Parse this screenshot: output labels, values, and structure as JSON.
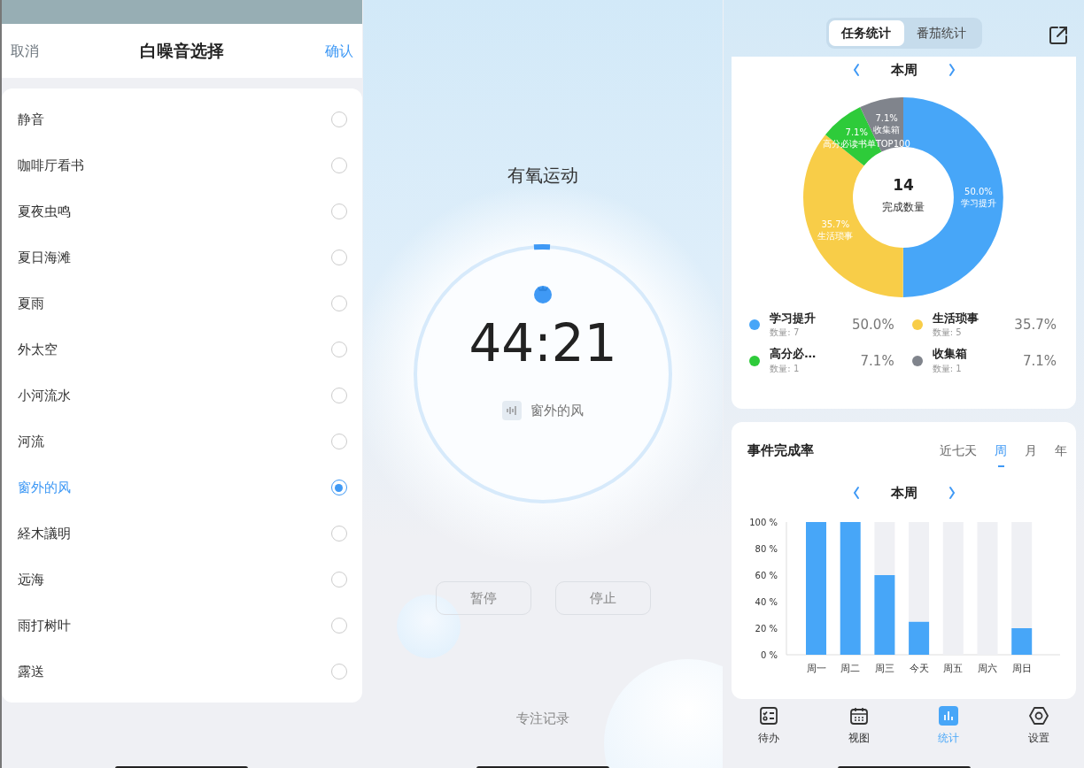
{
  "noise_picker": {
    "cancel": "取消",
    "title": "白噪音选择",
    "confirm": "确认",
    "options": [
      {
        "label": "静音",
        "selected": false
      },
      {
        "label": "咖啡厅看书",
        "selected": false
      },
      {
        "label": "夏夜虫鸣",
        "selected": false
      },
      {
        "label": "夏日海滩",
        "selected": false
      },
      {
        "label": "夏雨",
        "selected": false
      },
      {
        "label": "外太空",
        "selected": false
      },
      {
        "label": "小河流水",
        "selected": false
      },
      {
        "label": "河流",
        "selected": false
      },
      {
        "label": "窗外的风",
        "selected": true
      },
      {
        "label": "経木議明",
        "selected": false
      },
      {
        "label": "远海",
        "selected": false
      },
      {
        "label": "雨打树叶",
        "selected": false
      },
      {
        "label": "露送",
        "selected": false
      }
    ]
  },
  "focus_timer": {
    "task": "有氧运动",
    "level": 0.02,
    "time": "44:21",
    "sound": "窗外的风",
    "buttons": [
      "暂停",
      "停止"
    ],
    "history_link": "专注记录"
  },
  "stats": {
    "tabs": [
      {
        "label": "任务统计",
        "selected": true
      },
      {
        "label": "番茄统计",
        "selected": false
      }
    ],
    "task_card": {
      "period": "本周",
      "center_value": "14",
      "center_label": "完成数量",
      "chart_data": {
        "type": "donut",
        "categories": [
          "学习提升",
          "生活琐事",
          "高分必读书单TOP100",
          "收集箱"
        ],
        "values": [
          50.0,
          35.7,
          7.1,
          7.1
        ],
        "value_labels": [
          "50.0%",
          "35.7%",
          "7.1%",
          "7.1%"
        ]
      },
      "legend": [
        {
          "name": "学习提升",
          "count": "数量: 7",
          "percent": "50.0%",
          "color": "#47a6f8"
        },
        {
          "name": "生活琐事",
          "count": "数量: 5",
          "percent": "35.7%",
          "color": "#f8cd48"
        },
        {
          "name": "高分必…",
          "count": "数量: 1",
          "percent": "7.1%",
          "color": "#2ecb3a"
        },
        {
          "name": "收集箱",
          "count": "数量: 1",
          "percent": "7.1%",
          "color": "#80848c"
        }
      ]
    },
    "rate_card": {
      "title": "事件完成率",
      "ranges": [
        {
          "label": "近七天",
          "selected": false
        },
        {
          "label": "周",
          "selected": true
        },
        {
          "label": "月",
          "selected": false
        },
        {
          "label": "年",
          "selected": false
        }
      ],
      "period": "本周",
      "chart_data": {
        "type": "bar",
        "categories": [
          "周一",
          "周二",
          "周三",
          "今天",
          "周五",
          "周六",
          "周日"
        ],
        "series": [
          {
            "color": "#47a6f8",
            "values": [
              100,
              100,
              60,
              25,
              0,
              0,
              20
            ]
          },
          {
            "color": "#eff0f4",
            "values": [
              0,
              0,
              40,
              75,
              100,
              100,
              80
            ]
          }
        ],
        "stacked": true,
        "ylim": [
          0,
          100
        ],
        "yticks": [
          {
            "value": 0,
            "label": "0 %"
          },
          {
            "value": 20,
            "label": "20 %"
          },
          {
            "value": 40,
            "label": "40 %"
          },
          {
            "value": 60,
            "label": "60 %"
          },
          {
            "value": 80,
            "label": "80 %"
          },
          {
            "value": 100,
            "label": "100 %"
          }
        ]
      }
    },
    "nav": [
      {
        "label": "待办",
        "selected": false
      },
      {
        "label": "视图",
        "selected": false
      },
      {
        "label": "统计",
        "selected": true
      },
      {
        "label": "设置",
        "selected": false
      }
    ]
  }
}
